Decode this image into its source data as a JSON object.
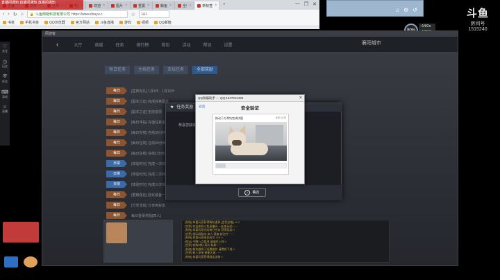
{
  "browser": {
    "tabs": [
      {
        "label": "主播"
      },
      {
        "label": "文件"
      },
      {
        "label": "全部"
      },
      {
        "label": "吃!"
      },
      {
        "label": "欢迎"
      },
      {
        "label": "图片"
      },
      {
        "label": "重置"
      },
      {
        "label": "鲸鱼"
      },
      {
        "label": "全!"
      },
      {
        "label": "新标签",
        "active": true
      }
    ],
    "address": {
      "secure_text": "斗鱼网络科技有限公司",
      "url": "https://www.douyu.c"
    },
    "address_extra": "1&1",
    "bookmarks": [
      {
        "label": "书签"
      },
      {
        "label": "手机书签"
      },
      {
        "label": "QQ浏览器"
      },
      {
        "label": "官方网站"
      },
      {
        "label": "斗鱼直播"
      },
      {
        "label": "游戏"
      },
      {
        "label": "视频"
      },
      {
        "label": "QQ邮箱"
      }
    ]
  },
  "overlay": {
    "banner_text": "直播间通知 直播间通知 直播间通知"
  },
  "douyu": {
    "logo_text": "斗鱼",
    "room_label": "房间号",
    "room_number": "1515240"
  },
  "gauge": {
    "value": "80",
    "unit": "%"
  },
  "speed": {
    "up": "14",
    "down": "172"
  },
  "left_strip": [
    {
      "icon": "heart-icon",
      "label": "关注"
    },
    {
      "icon": "history-icon",
      "label": "历史"
    },
    {
      "icon": "shield-icon",
      "label": "任务"
    },
    {
      "icon": "gamepad-icon",
      "label": "游戏"
    },
    {
      "icon": "robot-icon",
      "label": "直播"
    }
  ],
  "game": {
    "window_title": "网游客",
    "top_tabs": [
      "大厅",
      "商城",
      "任务",
      "排行榜",
      "背包",
      "活动",
      "帮派",
      "设置"
    ],
    "city": "襄阳城市",
    "quest_tabs": [
      "每日任务",
      "主线任务",
      "支线任务",
      "全部奖励"
    ],
    "quest_rows": [
      {
        "badge": "每日",
        "text": "[签到有礼] 1月4日 - 1月10日"
      },
      {
        "badge": "每日",
        "text": "[副本之证] 完成任意副本"
      },
      {
        "badge": "每日",
        "text": "[副本之证] 击败首领"
      },
      {
        "badge": "每日",
        "text": "[每日冲钻] 充值任意金额"
      },
      {
        "badge": "每日",
        "text": "[每日在线] 在线30分钟"
      },
      {
        "badge": "每日",
        "text": "[每日在线] 在线60分钟"
      },
      {
        "badge": "每日",
        "text": "[每日在线] 在线120分钟"
      },
      {
        "badge": "日常",
        "text": "[体验时光] 完成一次体验",
        "blue": true
      },
      {
        "badge": "日常",
        "text": "[体验时光] 完成二次体验",
        "blue": true
      },
      {
        "badge": "日常",
        "text": "[体验时光] 完成三次体验",
        "blue": true
      },
      {
        "badge": "每日",
        "text": "[重铸强化] 强化装备一次"
      },
      {
        "badge": "每日",
        "text": "[分享活动] 分享到好友"
      },
      {
        "badge": "每日",
        "text": "每日登录奖励[四人]"
      }
    ],
    "chat": [
      "[系统] 恭喜玩家获得稀有道具 [金色宝箱] x1 !!",
      "[世界] 欢迎来到斗鱼直播间 一起来玩吧 ~~~",
      "[系统] 恭喜玩家完成每日任务 获得奖励 !!",
      "[世界] 组队刷副本 来人 速度 缺治疗 ~~~",
      "[系统] 恭喜玩家强化成功 +15 !!",
      "[帮派] 今晚八点帮战 请准时上线 !!",
      "[世界] 收购材料 高价 私聊 ~~~",
      "[系统] 服务器将于凌晨维护 请提前下线 !!",
      "[世界] 新人求带 谢谢大佬 ~~~",
      "[系统] 恭喜玩家获得限定坐骑 !!"
    ]
  },
  "task_panel": {
    "title": "任务奖励",
    "body": "恭喜您获得以下奖励",
    "ok_label": "确定"
  },
  "dialog": {
    "title": "QQ防骗助手 --- QQ:1347912495",
    "back_label": "返回",
    "heading": "安全验证",
    "captcha_prompt": "拖动下方滑块完成拼图",
    "captcha_links": "刷新 反馈"
  },
  "colors": {
    "accent": "#3a78c8",
    "badge_orange": "#8a5530",
    "badge_blue": "#3a6aa8",
    "chat_gold": "#c9a23a"
  }
}
